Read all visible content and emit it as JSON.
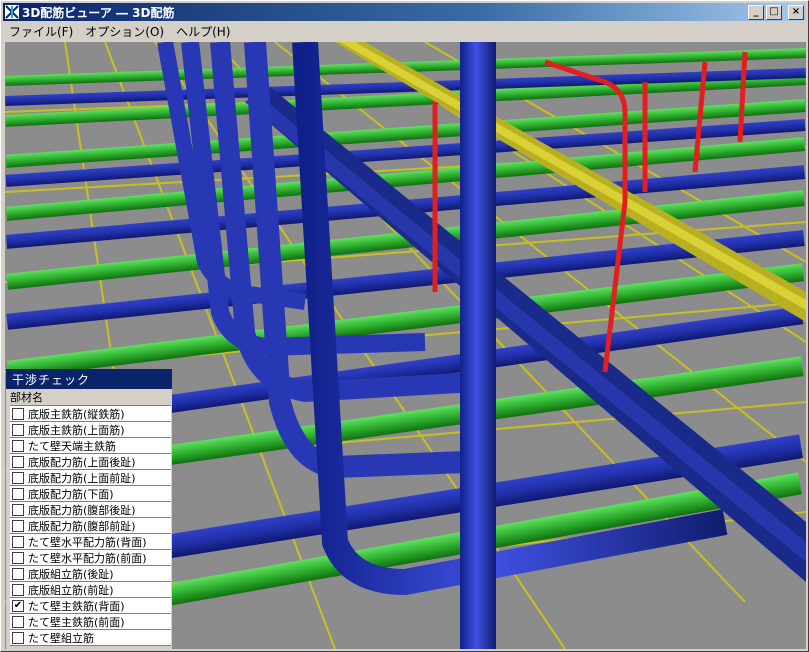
{
  "window": {
    "title": "3D配筋ビューア ― 3D配筋",
    "minimize": "_",
    "maximize": "□",
    "close": "×"
  },
  "menu": [
    {
      "label": "ファイル(F)"
    },
    {
      "label": "オプション(O)"
    },
    {
      "label": "ヘルプ(H)"
    }
  ],
  "colors": {
    "blue_bar": "#2838b4",
    "green_bar": "#30b030",
    "yellow_bar": "#c8c020",
    "red_bar": "#e02020",
    "floor": "#8c8c8c"
  },
  "panel": {
    "title": "干渉チェック",
    "header": "部材名",
    "items": [
      {
        "label": "底版主鉄筋(縦鉄筋)",
        "checked": false
      },
      {
        "label": "底版主鉄筋(上面筋)",
        "checked": false
      },
      {
        "label": "たて壁天端主鉄筋",
        "checked": false
      },
      {
        "label": "底版配力筋(上面後趾)",
        "checked": false
      },
      {
        "label": "底版配力筋(上面前趾)",
        "checked": false
      },
      {
        "label": "底版配力筋(下面)",
        "checked": false
      },
      {
        "label": "底版配力筋(腹部後趾)",
        "checked": false
      },
      {
        "label": "底版配力筋(腹部前趾)",
        "checked": false
      },
      {
        "label": "たて壁水平配力筋(背面)",
        "checked": false
      },
      {
        "label": "たて壁水平配力筋(前面)",
        "checked": false
      },
      {
        "label": "底版組立筋(後趾)",
        "checked": false
      },
      {
        "label": "底版組立筋(前趾)",
        "checked": false
      },
      {
        "label": "たて壁主鉄筋(背面)",
        "checked": true
      },
      {
        "label": "たて壁主鉄筋(前面)",
        "checked": false
      },
      {
        "label": "たて壁組立筋",
        "checked": false
      }
    ]
  }
}
